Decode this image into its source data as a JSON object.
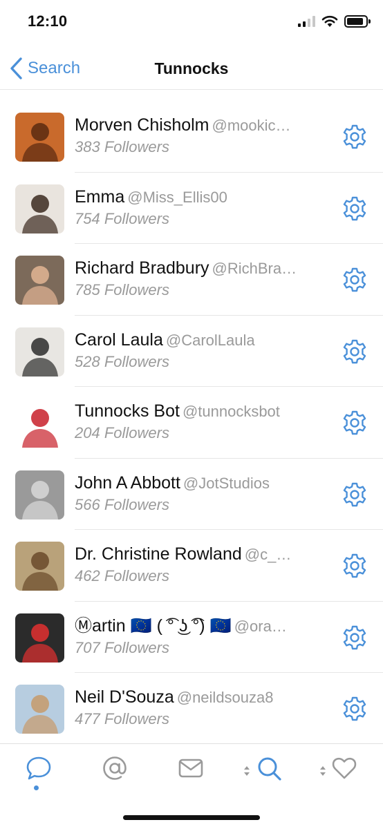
{
  "status_bar": {
    "time": "12:10"
  },
  "nav": {
    "back_label": "Search",
    "title": "Tunnocks"
  },
  "users": [
    {
      "name": "Morven Chisholm",
      "handle": "@mookic…",
      "followers": "383 Followers",
      "avatar_bg": "#c96a2c",
      "avatar_fg": "#5a2a10"
    },
    {
      "name": "Emma",
      "handle": "@Miss_Ellis00",
      "followers": "754 Followers",
      "avatar_bg": "#e9e4de",
      "avatar_fg": "#3b2a20"
    },
    {
      "name": "Richard Bradbury",
      "handle": "@RichBra…",
      "followers": "785 Followers",
      "avatar_bg": "#7c6a5a",
      "avatar_fg": "#e3b594"
    },
    {
      "name": "Carol Laula",
      "handle": "@CarolLaula",
      "followers": "528 Followers",
      "avatar_bg": "#e8e6e2",
      "avatar_fg": "#2c2c2c"
    },
    {
      "name": "Tunnocks Bot",
      "handle": "@tunnocksbot",
      "followers": "204 Followers",
      "avatar_bg": "#ffffff",
      "avatar_fg": "#c8202a"
    },
    {
      "name": "John A Abbott",
      "handle": "@JotStudios",
      "followers": "566 Followers",
      "avatar_bg": "#9a9a9a",
      "avatar_fg": "#d8d8d8"
    },
    {
      "name": "Dr. Christine Rowland",
      "handle": "@c_…",
      "followers": "462 Followers",
      "avatar_bg": "#b9a27a",
      "avatar_fg": "#6a4a2a"
    },
    {
      "name": "Ⓜartin 🇪🇺 ( ͡° ͜ʖ ͡°) 🇪🇺",
      "handle": "@ora…",
      "followers": "707 Followers",
      "avatar_bg": "#2b2b2b",
      "avatar_fg": "#e33030"
    },
    {
      "name": "Neil D'Souza",
      "handle": "@neildsouza8",
      "followers": "477 Followers",
      "avatar_bg": "#b7cde0",
      "avatar_fg": "#c79a6a"
    }
  ],
  "tabs": [
    {
      "name": "conversations",
      "icon": "speech-bubble-icon",
      "active": true
    },
    {
      "name": "mentions",
      "icon": "at-sign-icon",
      "active": false
    },
    {
      "name": "messages",
      "icon": "envelope-icon",
      "active": false
    },
    {
      "name": "search",
      "icon": "search-icon",
      "active": true
    },
    {
      "name": "favorites",
      "icon": "heart-icon",
      "active": false
    }
  ],
  "colors": {
    "accent": "#4a90d9",
    "muted": "#9a9a9a",
    "tab_inactive": "#9a9a9a"
  }
}
